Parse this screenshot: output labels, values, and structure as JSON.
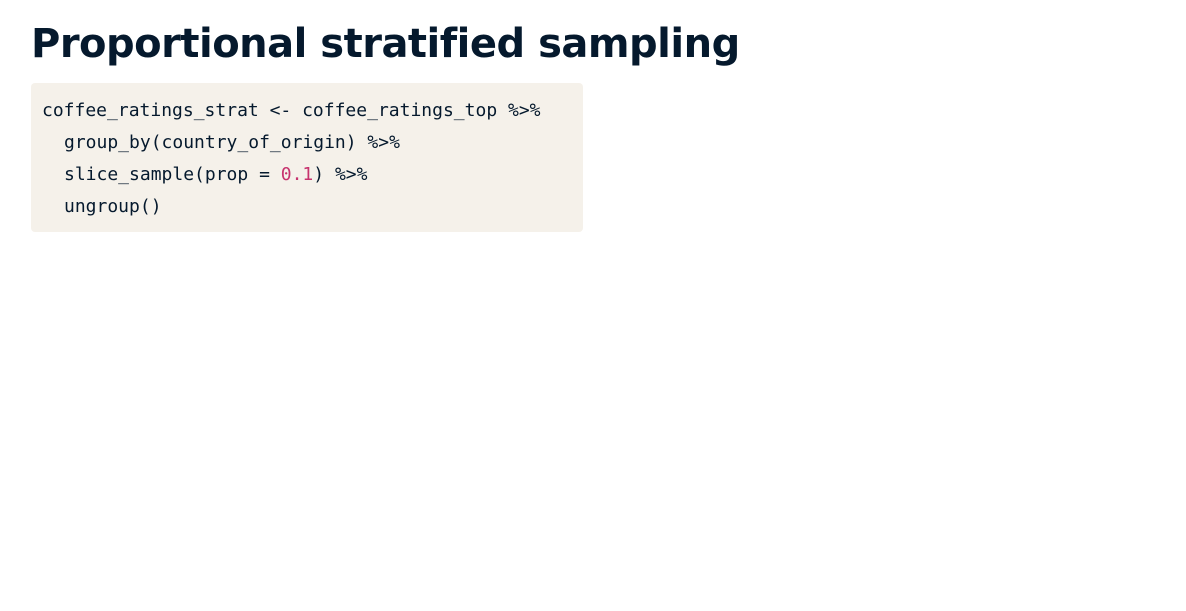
{
  "title": "Proportional stratified sampling",
  "code": {
    "line1": "coffee_ratings_strat <- coffee_ratings_top %>%",
    "line2": "group_by(country_of_origin) %>%",
    "line3_before": "slice_sample(prop = ",
    "line3_number": "0.1",
    "line3_after": ") %>%",
    "line4": "ungroup()"
  },
  "colors": {
    "title": "#05192d",
    "code_background": "#f5f1ea",
    "number_literal": "#c7336e"
  }
}
